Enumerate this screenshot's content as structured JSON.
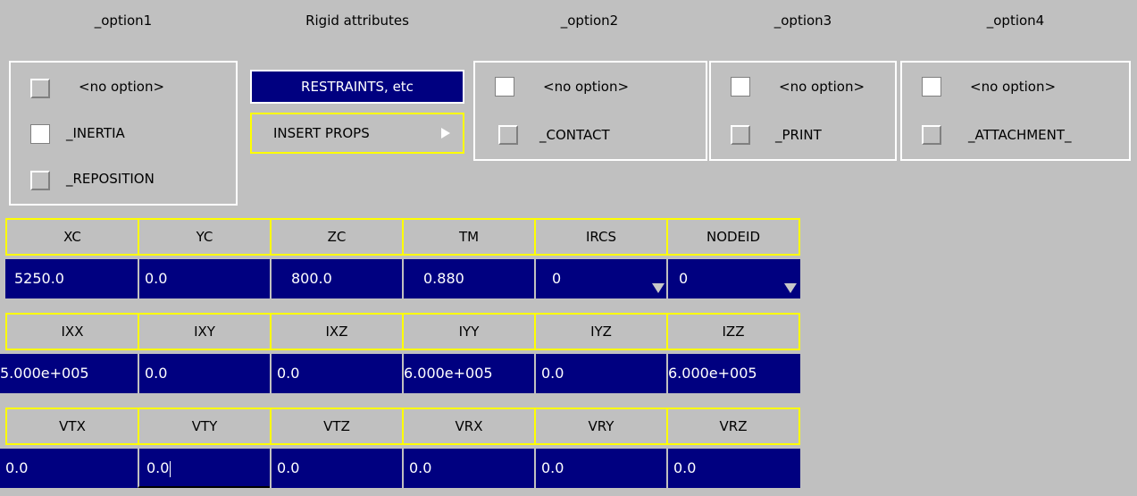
{
  "headers": {
    "option1": "_option1",
    "rigid": "Rigid attributes",
    "option2": "_option2",
    "option3": "_option3",
    "option4": "_option4"
  },
  "option1": {
    "items": [
      {
        "label": "<no option>",
        "checked": false
      },
      {
        "label": "_INERTIA",
        "checked": true
      },
      {
        "label": "_REPOSITION",
        "checked": false
      }
    ]
  },
  "rigid": {
    "restraints_label": "RESTRAINTS, etc",
    "insert_props_label": "INSERT PROPS"
  },
  "option2": {
    "items": [
      {
        "label": "<no option>",
        "checked": true
      },
      {
        "label": "_CONTACT",
        "checked": false
      }
    ]
  },
  "option3": {
    "items": [
      {
        "label": "<no option>",
        "checked": true
      },
      {
        "label": "_PRINT",
        "checked": false
      }
    ]
  },
  "option4": {
    "items": [
      {
        "label": "<no option>",
        "checked": true
      },
      {
        "label": "_ATTACHMENT_",
        "checked": false
      }
    ]
  },
  "table": {
    "row1": {
      "headers": [
        "XC",
        "YC",
        "ZC",
        "TM",
        "IRCS",
        "NODEID"
      ],
      "values": [
        "5250.0",
        "0.0",
        "800.0",
        "0.880",
        "0",
        "0"
      ]
    },
    "row2": {
      "headers": [
        "IXX",
        "IXY",
        "IXZ",
        "IYY",
        "IYZ",
        "IZZ"
      ],
      "values": [
        "5.000e+005",
        "0.0",
        "0.0",
        "6.000e+005",
        "0.0",
        "6.000e+005"
      ]
    },
    "row3": {
      "headers": [
        "VTX",
        "VTY",
        "VTZ",
        "VRX",
        "VRY",
        "VRZ"
      ],
      "values": [
        "0.0",
        "0.0",
        "0.0",
        "0.0",
        "0.0",
        "0.0"
      ]
    }
  },
  "colors": {
    "panel_bg": "#c0c0c0",
    "field_bg": "#000080",
    "field_border_highlight": "#ffff00"
  },
  "icons": {
    "dropdown": "dropdown-arrow-icon",
    "submenu": "submenu-triangle-icon"
  }
}
